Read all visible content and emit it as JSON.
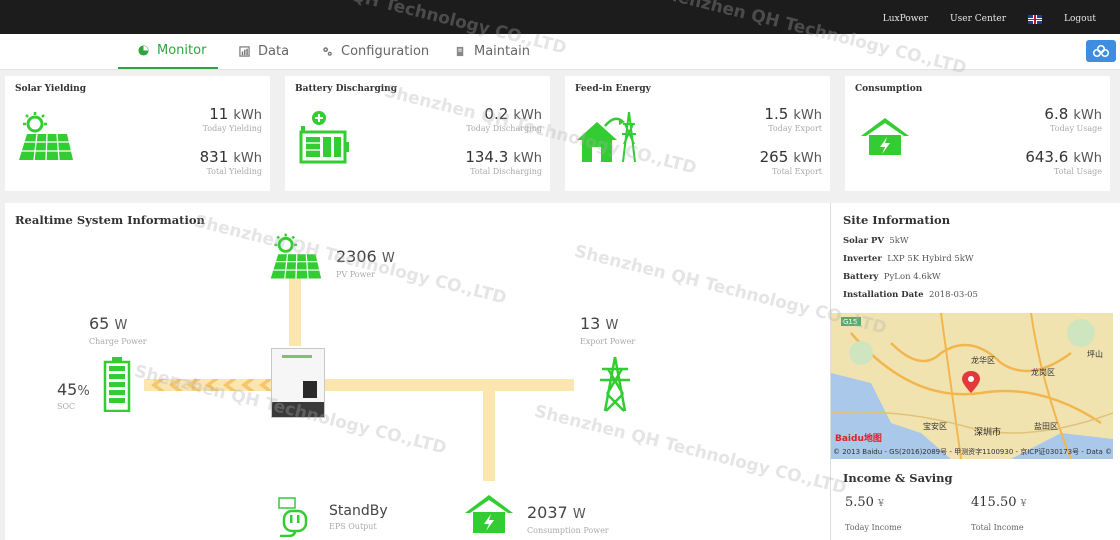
{
  "topbar": {
    "links": {
      "lux_power": "LuxPower",
      "user_center": "User Center",
      "logout": "Logout"
    },
    "flag_icon": "uk-flag-icon"
  },
  "nav": {
    "tabs": [
      {
        "label": "Monitor",
        "icon": "monitor-icon",
        "active": true
      },
      {
        "label": "Data",
        "icon": "bar-chart-icon",
        "active": false
      },
      {
        "label": "Configuration",
        "icon": "gear-icon",
        "active": false
      },
      {
        "label": "Maintain",
        "icon": "tools-icon",
        "active": false
      }
    ],
    "accent": "#2ea53f"
  },
  "cards": [
    {
      "title": "Solar Yielding",
      "icon": "solar-panel-icon",
      "top": {
        "value": "11",
        "unit": "kWh",
        "caption": "Today Yielding"
      },
      "bottom": {
        "value": "831",
        "unit": "kWh",
        "caption": "Total Yielding"
      }
    },
    {
      "title": "Battery Discharging",
      "icon": "battery-discharge-icon",
      "top": {
        "value": "0.2",
        "unit": "kWh",
        "caption": "Today Discharging"
      },
      "bottom": {
        "value": "134.3",
        "unit": "kWh",
        "caption": "Total Discharging"
      }
    },
    {
      "title": "Feed-in Energy",
      "icon": "grid-house-icon",
      "top": {
        "value": "1.5",
        "unit": "kWh",
        "caption": "Today Export"
      },
      "bottom": {
        "value": "265",
        "unit": "kWh",
        "caption": "Total Export"
      }
    },
    {
      "title": "Consumption",
      "icon": "house-bolt-icon",
      "top": {
        "value": "6.8",
        "unit": "kWh",
        "caption": "Today Usage"
      },
      "bottom": {
        "value": "643.6",
        "unit": "kWh",
        "caption": "Total Usage"
      }
    }
  ],
  "realtime": {
    "title": "Realtime System Information",
    "pv": {
      "value": "2306",
      "unit": "W",
      "label": "PV Power"
    },
    "charge": {
      "value": "65",
      "unit": "W",
      "label": "Charge Power"
    },
    "soc": {
      "value": "45",
      "unit": "%",
      "label": "SOC"
    },
    "export": {
      "value": "13",
      "unit": "W",
      "label": "Export Power"
    },
    "eps": {
      "value": "StandBy",
      "label": "EPS Output"
    },
    "consumption": {
      "value": "2037",
      "unit": "W",
      "label": "Consumption Power"
    }
  },
  "site": {
    "title": "Site Information",
    "rows": [
      {
        "key": "Solar PV",
        "value": "5kW"
      },
      {
        "key": "Inverter",
        "value": "LXP 5K Hybird 5kW"
      },
      {
        "key": "Battery",
        "value": "PyLon 4.6kW"
      },
      {
        "key": "Installation Date",
        "value": "2018-03-05"
      }
    ],
    "map": {
      "road_label": "G15",
      "labels": [
        "龙华区",
        "龙岗区",
        "宝安区",
        "深圳市",
        "盐田区",
        "坪山"
      ],
      "brand": "Baidu地图",
      "credit": "© 2013 Baidu - GS(2016)2089号 - 甲测资字1100930 - 京ICP证030173号 - Data ©"
    },
    "income_title": "Income & Saving",
    "today_income": {
      "value": "5.50",
      "unit": "¥",
      "label": "Today Income"
    },
    "total_income": {
      "value": "415.50",
      "unit": "¥",
      "label": "Total Income"
    }
  },
  "watermark_text": "Shenzhen QH Technology CO.,LTD",
  "colors": {
    "green": "#33cc33",
    "flow": "#fbe6b0",
    "flow_arrow": "#f6c76a"
  }
}
